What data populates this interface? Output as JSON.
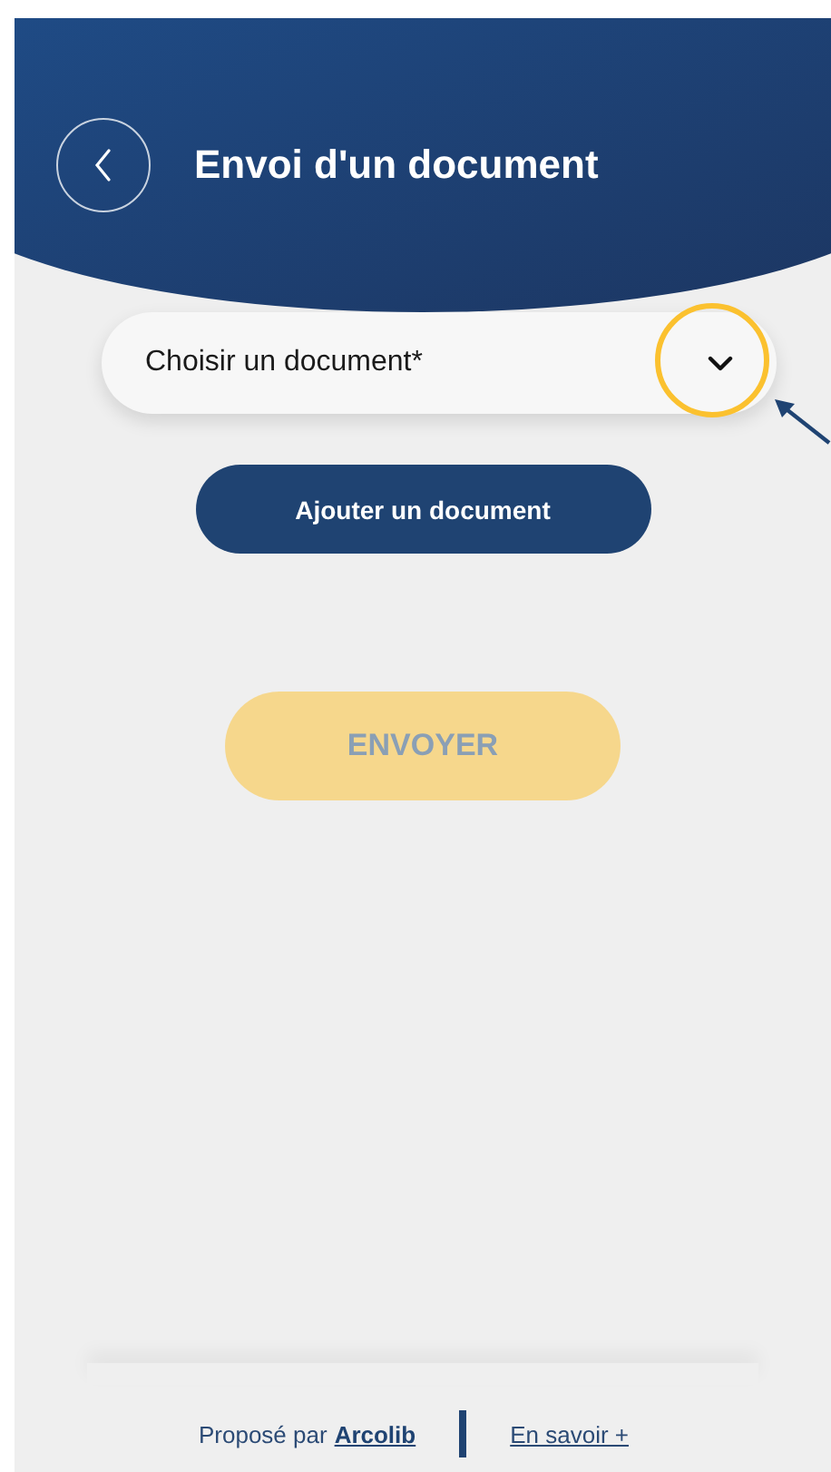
{
  "header": {
    "title": "Envoi d'un document"
  },
  "document_select": {
    "placeholder": "Choisir un document*"
  },
  "buttons": [
    {
      "label": "Ajouter un document",
      "kind": "secondary",
      "disabled": false
    },
    {
      "label": "ENVOYER",
      "kind": "primary",
      "disabled": true
    }
  ],
  "annotation": {
    "kind": "highlight"
  },
  "footer": {
    "prefix": "Proposé par",
    "brand_link": "Arcolib",
    "more_link": "En savoir +"
  }
}
